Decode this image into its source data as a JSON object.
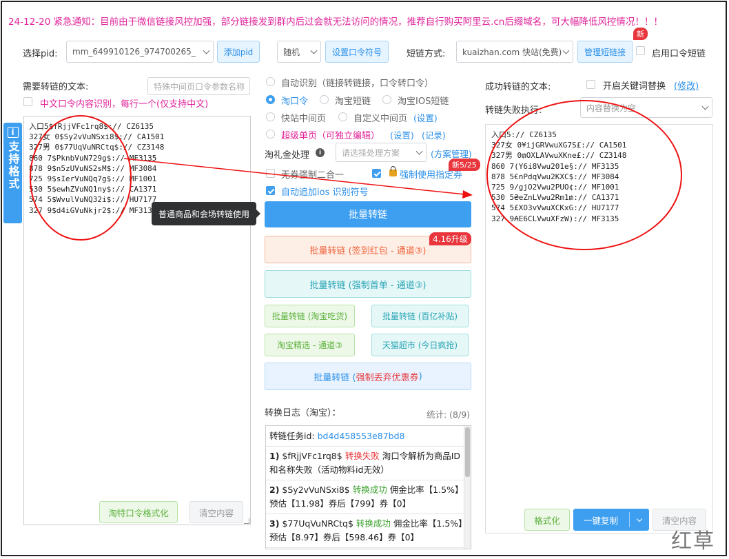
{
  "notice": "24-12-20 紧急通知：目前由于微信链接风控加强，部分链接发到群内后过会就无法访问的情况，推荐自行购买阿里云.cn后缀域名，可大幅降低风控情况！！！",
  "top": {
    "pid_label": "选择pid:",
    "pid_value": "mm_649910126_974700265_",
    "add_pid": "添加pid",
    "random_value": "随机",
    "set_code": "设置口令符号",
    "short_label": "短链方式:",
    "short_value": "kuaizhan.com 快站(免费)",
    "manage_short": "管理短链接",
    "new_badge": "新",
    "use_code_short": "启用口令短链"
  },
  "left": {
    "title": "需要转链的文本:",
    "param_placeholder": "特殊中间页口令参数名称",
    "cn_recognize": "中文口令内容识别，每行一个(仅支持中文)",
    "side_tab": "支持格式",
    "input_lines": [
      "入口5$fRjjVFc1rq8$:// CZ6135",
      "327女 0$Sy2vVuNSxi8$:// CA1501",
      "327男 0$77UqVuNRCtq$:// CZ3148",
      "860 7$PknbVuN729g$:// MF3135",
      "878 9$n5zUVuNS2sM$:// MF3084",
      "725 9$sIerVuNQq7g$:// MF1001",
      "530 5$ewhZVuNQ1ny$:// CA1371",
      "574 5$WvulVuNQ32i$:// HU7177",
      "327 9$d4iGVuNkjr2$:// MF3135"
    ],
    "format_btn": "淘特口令格式化",
    "clear_btn": "清空内容",
    "tooltip": "普通商品和会场转链使用"
  },
  "middle": {
    "modes": [
      {
        "label": "自动识别（链接转链接，口令转口令）",
        "checked": false
      },
      {
        "label": "淘口令",
        "checked": true
      },
      {
        "label": "淘宝短链",
        "checked": false
      },
      {
        "label": "淘宝IOS短链",
        "checked": false
      },
      {
        "label": "快站中间页",
        "checked": false
      },
      {
        "label": "自定义中间页",
        "checked": false
      },
      {
        "label": "超级单页（可独立编辑）",
        "checked": false
      }
    ],
    "settings_link": "(设置)",
    "settings_link2": "(设置)",
    "record_link": "(记录)",
    "tlj_label": "淘礼金处理",
    "tlj_placeholder": "请选择处理方案",
    "plan_manage": "(方案管理)",
    "no_coupon": "无券强制二合一",
    "force_coupon": "强制使用指定券",
    "new_tag_1": "新5/25",
    "auto_ios": "自动追加ios 识别符号",
    "batch_main": "批量转链",
    "upgrade_tag": "4.16升级",
    "batch_redpack": "批量转链 (签到红包 - 通道③)",
    "batch_first": "批量转链 (强制首单 - 通道③)",
    "batch_chihuo": "批量转链 (淘宝吃货)",
    "batch_baiyi": "批量转链 (百亿补贴)",
    "taobao_jingxuan": "淘宝精选 - 通道③",
    "tmall_market": "天猫超市 (今日疯抢)",
    "batch_drop_prefix": "批量转链 (",
    "batch_drop_red": "强制丢弃优惠券",
    "batch_drop_suffix": ")",
    "log_title": "转换日志（淘宝）：",
    "stats": "统计: (8/9)",
    "task_label": "转链任务id:",
    "task_id": "bd4d458553e87bd8",
    "logs": [
      {
        "idx": "1)",
        "code": "$fRjjVFc1rq8$",
        "status": "转换失败",
        "status_type": "fail",
        "rest": "淘口令解析为商品ID和名称失败（活动物料id无效）"
      },
      {
        "idx": "2)",
        "code": "$Sy2vVuNSxi8$",
        "status": "转换成功",
        "status_type": "ok",
        "rest": "佣金比率【1.5%】预估【11.98】券后【799】券【0】"
      },
      {
        "idx": "3)",
        "code": "$77UqVuNRCtq$",
        "status": "转换成功",
        "status_type": "ok",
        "rest": "佣金比率【1.5%】预估【8.97】券后【598.46】券【0】"
      }
    ]
  },
  "right": {
    "title": "成功转链的文本:",
    "keyword_replace": "开启关键词替换",
    "modify": "(修改)",
    "fail_label": "转链失败执行:",
    "fail_value": "内容替换为空",
    "output_lines": [
      "入口5:// CZ6135",
      "327女 0¥ijGRVwuXG7S£:// CA1501",
      "327男 0₥OXLAVwuXKne£:// CZ3148",
      "860 7(Y6i8Vwu201e§:// MF3135",
      "878 5€nPdqVwu2KXC$:// MF3084",
      "725 9/gjO2Vwu2PUO¢:// MF1001",
      "530 5₴eZnLVwu2Rm1₥:// CA1371",
      "574 5£XO3vVwuXCKxG:// HU7177",
      "327 9₳E6CLVwuXFzW):// MF3135"
    ],
    "format_btn": "格式化",
    "copy_btn": "一键复制",
    "clear_btn": "清空内容"
  },
  "watermark": "红草"
}
